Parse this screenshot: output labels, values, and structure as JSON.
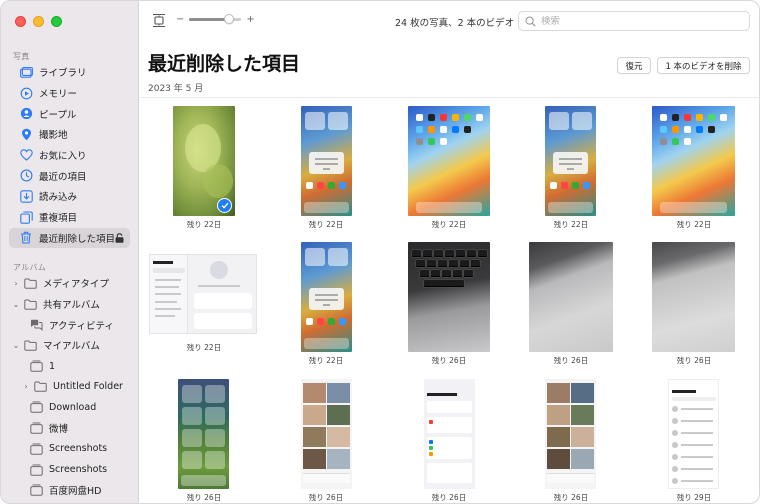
{
  "sidebar": {
    "section_photos": "写真",
    "section_albums": "アルバム",
    "items": [
      {
        "label": "ライブラリ",
        "icon": "library-icon"
      },
      {
        "label": "メモリー",
        "icon": "memories-icon"
      },
      {
        "label": "ピープル",
        "icon": "people-icon"
      },
      {
        "label": "撮影地",
        "icon": "places-icon"
      },
      {
        "label": "お気に入り",
        "icon": "heart-icon"
      },
      {
        "label": "最近の項目",
        "icon": "clock-icon"
      },
      {
        "label": "読み込み",
        "icon": "import-icon"
      },
      {
        "label": "重複項目",
        "icon": "duplicates-icon"
      },
      {
        "label": "最近削除した項目",
        "icon": "trash-icon"
      }
    ],
    "albums": [
      {
        "label": "メディアタイプ"
      },
      {
        "label": "共有アルバム"
      },
      {
        "label": "アクティビティ"
      },
      {
        "label": "マイアルバム"
      },
      {
        "label": "1"
      },
      {
        "label": "Untitled Folder"
      },
      {
        "label": "Download"
      },
      {
        "label": "微博"
      },
      {
        "label": "Screenshots"
      },
      {
        "label": "Screenshots"
      },
      {
        "label": "百度网盘HD"
      }
    ]
  },
  "toolbar": {
    "zoom_minus": "−",
    "zoom_plus": "+",
    "zoom_level": 0.76,
    "summary": "24 枚の写真、2 本のビデオ",
    "search_placeholder": "検索"
  },
  "header": {
    "title": "最近削除した項目",
    "date": "2023 年 5 月",
    "restore_label": "復元",
    "delete_label": "1 本のビデオを削除"
  },
  "grid": {
    "captions": [
      "残り 22日",
      "残り 22日",
      "残り 22日",
      "残り 22日",
      "残り 22日",
      "残り 22日",
      "残り 22日",
      "残り 26日",
      "残り 26日",
      "残り 26日",
      "残り 26日",
      "残り 26日",
      "残り 26日",
      "残り 26日",
      "残り 29日"
    ]
  },
  "colors": {
    "sidebar_bg": "#ebe7ea",
    "selected_bg": "#d9d4d8",
    "accent": "#1f7ef0",
    "icon_tint": "#2d7cf6"
  }
}
